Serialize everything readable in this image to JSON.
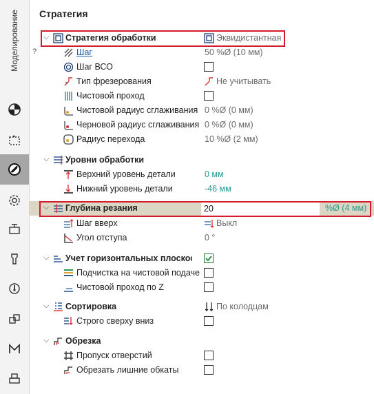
{
  "toolbar": {
    "modeling_tab_label": "Моделирование",
    "buttons": [
      "design-mode-icon",
      "selection-icon",
      "strategy-icon",
      "settings-gear-icon",
      "machining-icon",
      "tool-icon",
      "origin-icon",
      "copy-icon",
      "macro-icon",
      "printer-icon"
    ],
    "active_button": "strategy-icon",
    "active_color": "#a6a6a6"
  },
  "panel": {
    "title": "Стратегия",
    "help_mark": "?",
    "groups": {
      "strategy": {
        "label": "Стратегия обработки",
        "value": "Эквидистантная",
        "items": {
          "step": {
            "label": "Шаг",
            "value": "50 %Ø (10 мм)"
          },
          "step_vso": {
            "label": "Шаг ВСО"
          },
          "milling_type": {
            "label": "Тип фрезерования",
            "value": "Не учитывать"
          },
          "finish_pass": {
            "label": "Чистовой проход"
          },
          "finish_smooth_radius": {
            "label": "Чистовой радиус сглаживания",
            "value": "0 %Ø (0 мм)"
          },
          "rough_smooth_radius": {
            "label": "Черновой радиус сглаживания",
            "value": "0 %Ø (0 мм)"
          },
          "transition_radius": {
            "label": "Радиус перехода",
            "value": "10 %Ø (2 мм)"
          }
        }
      },
      "levels": {
        "label": "Уровни обработки",
        "items": {
          "top": {
            "label": "Верхний уровень детали",
            "value": "0 мм"
          },
          "bottom": {
            "label": "Нижний уровень детали",
            "value": "-46 мм"
          }
        }
      },
      "depth": {
        "label": "Глубина резания",
        "input_value": "20",
        "unit": "%Ø (4 мм)",
        "items": {
          "step_up": {
            "label": "Шаг вверх",
            "value": "Выкл"
          },
          "retract_angle": {
            "label": "Угол отступа",
            "value": "0 °"
          }
        }
      },
      "horizontal": {
        "label": "Учет горизонтальных плоскостей",
        "checked": true,
        "items": {
          "cleanup": {
            "label": "Подчистка на чистовой подаче"
          },
          "finish_z": {
            "label": "Чистовой проход по Z"
          }
        }
      },
      "sorting": {
        "label": "Сортировка",
        "value": "По колодцам",
        "items": {
          "top_down": {
            "label": "Строго сверху вниз"
          }
        }
      },
      "trimming": {
        "label": "Обрезка",
        "items": {
          "skip_holes": {
            "label": "Пропуск отверстий"
          },
          "trim_extra": {
            "label": "Обрезать лишние обкаты"
          }
        }
      }
    }
  },
  "colors": {
    "highlight": "#d51a2a",
    "teal": "#2a9a93",
    "link": "#1e5fa8",
    "edit_row": "#dcd6c4"
  }
}
